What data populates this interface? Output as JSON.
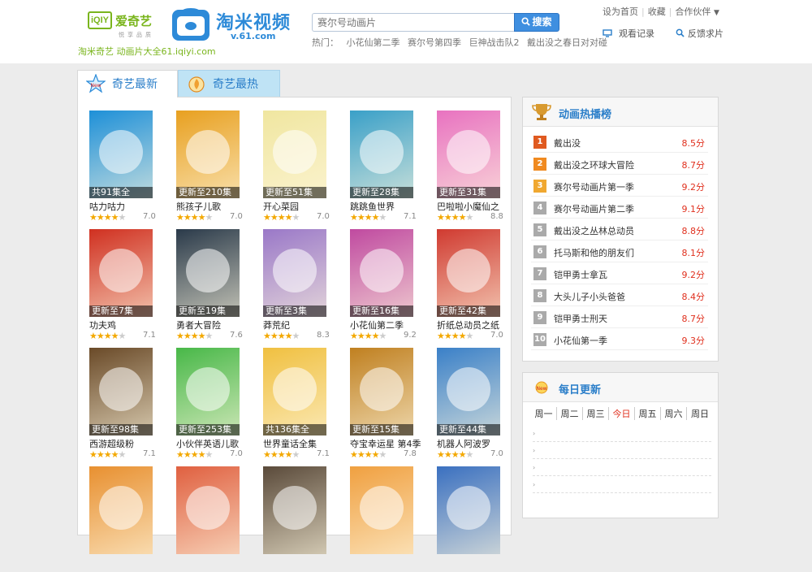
{
  "header": {
    "iqiyi_logo_box": "iQIY",
    "iqiyi_logo_text": "爱奇艺",
    "iqiyi_logo_sub": "悦享品质",
    "taomi_name": "淘米视频",
    "taomi_url": "v.61.com",
    "tagline": "淘米奇艺 动画片大全61.iqiyi.com",
    "search_placeholder": "赛尔号动画片",
    "search_button": "搜索",
    "hot_label": "热门：",
    "hot_items": [
      "小花仙第二季",
      "赛尔号第四季",
      "巨神战击队2",
      "戴出没之春日对对碰"
    ],
    "top_links": [
      "设为首页",
      "收藏",
      "合作伙伴"
    ],
    "sub_tools": [
      "观看记录",
      "反馈求片"
    ]
  },
  "tabs": {
    "new": "奇艺最新",
    "hot": "奇艺最热"
  },
  "grid": [
    {
      "title": "咕力咕力",
      "caption": "共91集全",
      "score": "7.0",
      "stars": 4,
      "color": "#1e90d8"
    },
    {
      "title": "熊孩子儿歌",
      "caption": "更新至210集",
      "score": "7.0",
      "stars": 4,
      "color": "#e8a020"
    },
    {
      "title": "开心菜园",
      "caption": "更新至51集",
      "score": "7.0",
      "stars": 4,
      "color": "#f0e6a0"
    },
    {
      "title": "跳跳鱼世界",
      "caption": "更新至28集",
      "score": "7.1",
      "stars": 4,
      "color": "#3aa0c8"
    },
    {
      "title": "巴啦啦小魔仙之",
      "caption": "更新至31集",
      "score": "8.8",
      "stars": 4,
      "color": "#e872c0"
    },
    {
      "title": "功夫鸡",
      "caption": "更新至7集",
      "score": "7.1",
      "stars": 4,
      "color": "#d03020"
    },
    {
      "title": "勇者大冒险",
      "caption": "更新至19集",
      "score": "7.6",
      "stars": 4,
      "color": "#2a3a4a"
    },
    {
      "title": "莽荒纪",
      "caption": "更新至3集",
      "score": "8.3",
      "stars": 4,
      "color": "#9a78c8"
    },
    {
      "title": "小花仙第二季",
      "caption": "更新至16集",
      "score": "9.2",
      "stars": 4,
      "color": "#c04aa0"
    },
    {
      "title": "折纸总动员之纸",
      "caption": "更新至42集",
      "score": "7.0",
      "stars": 4,
      "color": "#d03a30"
    },
    {
      "title": "西游超级粉",
      "caption": "更新至98集",
      "score": "7.1",
      "stars": 4,
      "color": "#6a4a28"
    },
    {
      "title": "小伙伴英语儿歌",
      "caption": "更新至253集",
      "score": "7.0",
      "stars": 4,
      "color": "#48b848"
    },
    {
      "title": "世界童话全集",
      "caption": "共136集全",
      "score": "7.1",
      "stars": 4,
      "color": "#f0c040"
    },
    {
      "title": "夺宝幸运星 第4季",
      "caption": "更新至15集",
      "score": "7.8",
      "stars": 4,
      "color": "#c08020"
    },
    {
      "title": "机器人阿波罗",
      "caption": "更新至44集",
      "score": "7.0",
      "stars": 4,
      "color": "#3a80c8"
    },
    {
      "title": "",
      "caption": "",
      "score": "",
      "stars": 0,
      "color": "#e89030"
    },
    {
      "title": "",
      "caption": "",
      "score": "",
      "stars": 0,
      "color": "#e06040"
    },
    {
      "title": "",
      "caption": "",
      "score": "",
      "stars": 0,
      "color": "#5a4a3a"
    },
    {
      "title": "",
      "caption": "",
      "score": "",
      "stars": 0,
      "color": "#f0a040"
    },
    {
      "title": "",
      "caption": "",
      "score": "",
      "stars": 0,
      "color": "#3a70c0"
    }
  ],
  "rank": {
    "title": "动画热播榜",
    "items": [
      {
        "num": "1",
        "name": "戴出没",
        "score": "8.5分",
        "color": "#e05a20"
      },
      {
        "num": "2",
        "name": "戴出没之环球大冒险",
        "score": "8.7分",
        "color": "#f08a20"
      },
      {
        "num": "3",
        "name": "赛尔号动画片第一季",
        "score": "9.2分",
        "color": "#f0a830"
      },
      {
        "num": "4",
        "name": "赛尔号动画片第二季",
        "score": "9.1分",
        "color": "#aaaaaa"
      },
      {
        "num": "5",
        "name": "戴出没之丛林总动员",
        "score": "8.8分",
        "color": "#aaaaaa"
      },
      {
        "num": "6",
        "name": "托马斯和他的朋友们",
        "score": "8.1分",
        "color": "#aaaaaa"
      },
      {
        "num": "7",
        "name": "铠甲勇士拿瓦",
        "score": "9.2分",
        "color": "#aaaaaa"
      },
      {
        "num": "8",
        "name": "大头儿子小头爸爸",
        "score": "8.4分",
        "color": "#aaaaaa"
      },
      {
        "num": "9",
        "name": "铠甲勇士刑天",
        "score": "8.7分",
        "color": "#aaaaaa"
      },
      {
        "num": "10",
        "name": "小花仙第一季",
        "score": "9.3分",
        "color": "#aaaaaa"
      }
    ]
  },
  "daily": {
    "title": "每日更新",
    "days": [
      "周一",
      "周二",
      "周三",
      "今日",
      "周五",
      "周六",
      "周日"
    ],
    "today_index": 3
  }
}
